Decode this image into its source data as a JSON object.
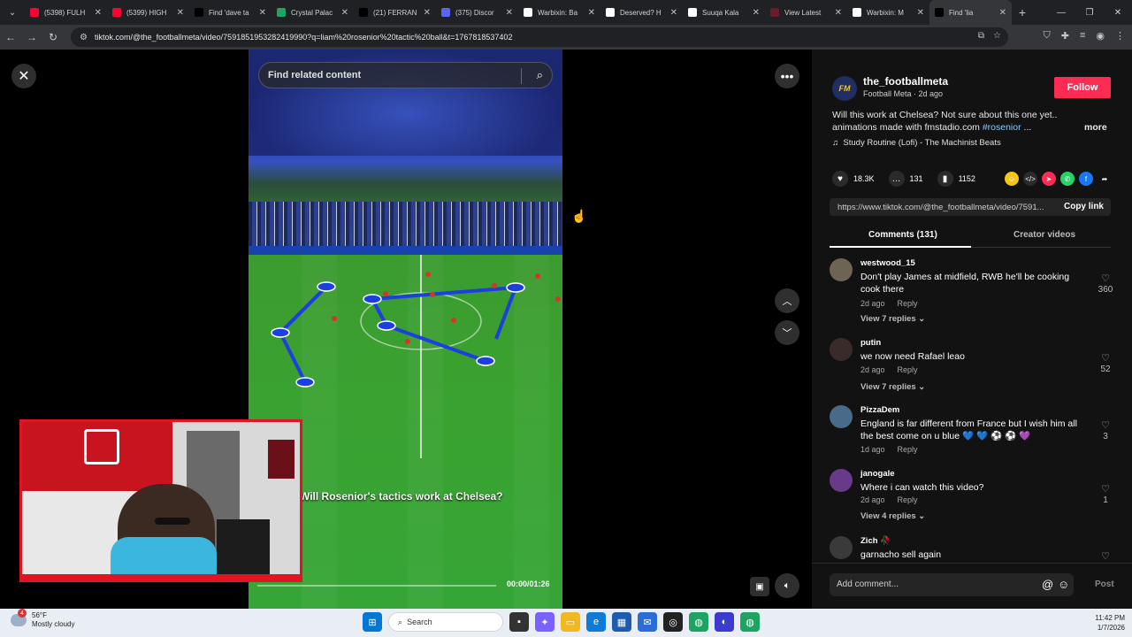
{
  "browser": {
    "tabs": [
      {
        "label": "(5398) FULH",
        "color": "#ff0033",
        "active": false
      },
      {
        "label": "(5399) HIGH",
        "color": "#ff0033",
        "active": false
      },
      {
        "label": "Find 'dave ta",
        "color": "#000000",
        "active": false
      },
      {
        "label": "Crystal Palac",
        "color": "#1fa463",
        "active": false
      },
      {
        "label": "(21) FERRAN",
        "color": "#000000",
        "active": false
      },
      {
        "label": "(375) Discor",
        "color": "#5865f2",
        "active": false
      },
      {
        "label": "Warbixin: Ba",
        "color": "#ffffff",
        "active": false
      },
      {
        "label": "Deserved? H",
        "color": "#ffffff",
        "active": false
      },
      {
        "label": "Suuqa Kala",
        "color": "#ffffff",
        "active": false
      },
      {
        "label": "View Latest",
        "color": "#6a1b2a",
        "active": false
      },
      {
        "label": "Warbixin: M",
        "color": "#ffffff",
        "active": false
      },
      {
        "label": "Find 'lia",
        "color": "#000000",
        "active": true
      }
    ],
    "new_tab": "+",
    "url": "tiktok.com/@the_footballmeta/video/7591851953282419990?q=liam%20rosenior%20tactic%20ball&t=1767818537402"
  },
  "video": {
    "search_placeholder": "Find related content",
    "caption": "Will Rosenior's tactics work at Chelsea?",
    "timecode": "00:00/01:26",
    "progress": 0.0
  },
  "panel": {
    "author": {
      "avatar_text": "FM",
      "username": "the_footballmeta",
      "display_name": "Football Meta",
      "posted": "2d ago",
      "follow_label": "Follow"
    },
    "description_line1": "Will this work at Chelsea? Not sure about this one yet..",
    "description_line2_text": "animations made with fmstadio.com ",
    "description_hashtag": "#rosenior",
    "description_ellipsis": " ...",
    "more_label": "more",
    "music": "Study Routine (Lofi) - The Machinist Beats",
    "stats": {
      "likes": "18.3K",
      "comments": "131",
      "saves": "1152"
    },
    "share_link": "https://www.tiktok.com/@the_footballmeta/video/7591...",
    "copy_label": "Copy link",
    "tabs": {
      "comments": "Comments (131)",
      "creator": "Creator videos"
    },
    "comments": [
      {
        "user": "westwood_15",
        "text": "Don't play James at midfield, RWB he'll be cooking cook there",
        "time": "2d ago",
        "reply": "Reply",
        "likes": "360",
        "replies": "View 7 replies",
        "avatar_color": "#6d6456"
      },
      {
        "user": "putin",
        "text": "we now need Rafael leao",
        "time": "2d ago",
        "reply": "Reply",
        "likes": "52",
        "replies": "View 7 replies",
        "avatar_color": "#3a2b2b"
      },
      {
        "user": "PizzaDem",
        "text": "England is far different from France but I wish him all the best come on u blue 💙 💙 ⚽ ⚽ 💜",
        "time": "1d ago",
        "reply": "Reply",
        "likes": "3",
        "replies": "",
        "avatar_color": "#4a6a8a"
      },
      {
        "user": "janogale",
        "text": "Where i can watch this video?",
        "time": "2d ago",
        "reply": "Reply",
        "likes": "1",
        "replies": "View 4 replies",
        "avatar_color": "#6a3a8a"
      },
      {
        "user": "Zich 🥀",
        "text": "garnacho sell again",
        "time": "",
        "reply": "",
        "likes": "",
        "replies": "",
        "avatar_color": "#3a3a3a"
      }
    ],
    "add_comment_placeholder": "Add comment...",
    "post_label": "Post"
  },
  "taskbar": {
    "weather_temp": "56°F",
    "weather_desc": "Mostly cloudy",
    "weather_badge": "4",
    "search_label": "Search",
    "time": "11:42 PM",
    "date": "1/7/2026"
  }
}
